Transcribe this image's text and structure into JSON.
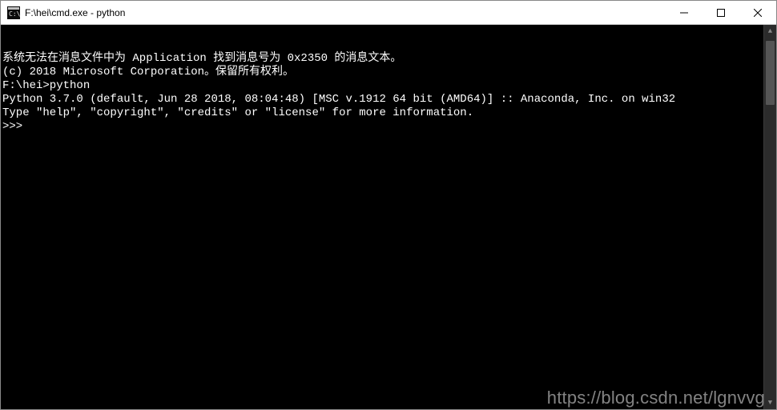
{
  "window": {
    "title": "F:\\hei\\cmd.exe - python"
  },
  "terminal": {
    "lines": [
      "系统无法在消息文件中为 Application 找到消息号为 0x2350 的消息文本。",
      "",
      "(c) 2018 Microsoft Corporation。保留所有权利。",
      "",
      "F:\\hei>python",
      "Python 3.7.0 (default, Jun 28 2018, 08:04:48) [MSC v.1912 64 bit (AMD64)] :: Anaconda, Inc. on win32",
      "Type \"help\", \"copyright\", \"credits\" or \"license\" for more information.",
      ">>>"
    ]
  },
  "watermark": {
    "text": "https://blog.csdn.net/lgnvvg"
  }
}
